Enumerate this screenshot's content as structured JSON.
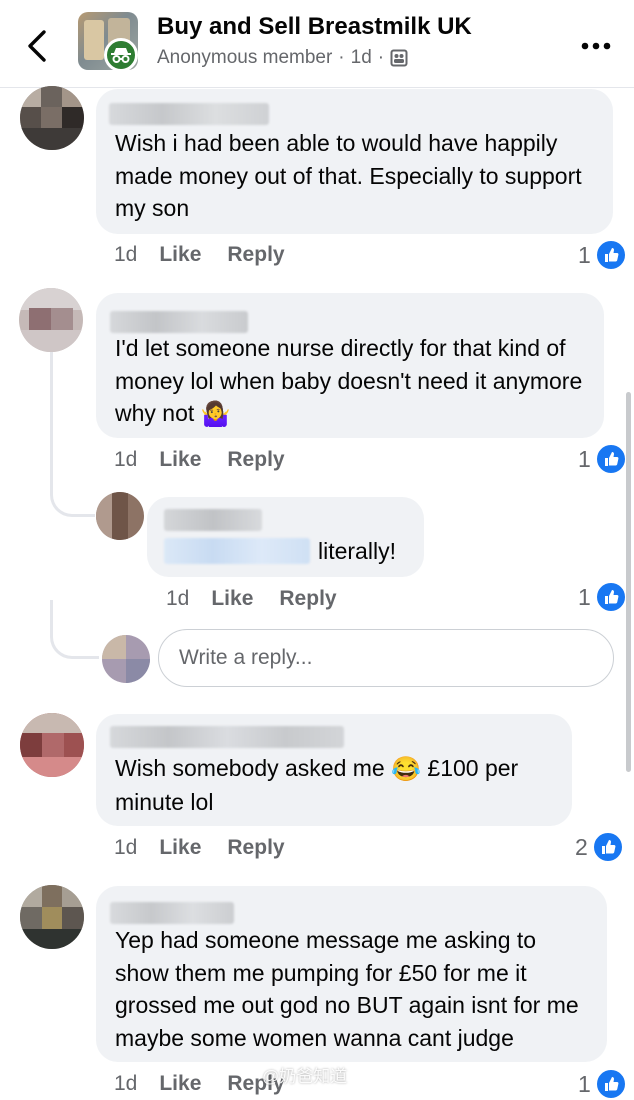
{
  "header": {
    "title": "Buy and Sell Breastmilk UK",
    "author": "Anonymous member",
    "time": "1d",
    "separator": "·"
  },
  "comments": [
    {
      "text": "Wish i had been able to would have happily made money out of that. Especially to support my son",
      "time": "1d",
      "like_label": "Like",
      "reply_label": "Reply",
      "reaction_count": "1"
    },
    {
      "text": "I'd let someone nurse directly for that kind of money lol when baby doesn't need it anymore why not",
      "emoji": "🤷‍♀️",
      "time": "1d",
      "like_label": "Like",
      "reply_label": "Reply",
      "reaction_count": "1"
    },
    {
      "text": "Wish somebody asked me",
      "emoji": "😂",
      "text_after": "£100 per minute lol",
      "time": "1d",
      "like_label": "Like",
      "reply_label": "Reply",
      "reaction_count": "2"
    },
    {
      "text": "Yep had someone message me asking to show them me pumping for £50 for me it grossed me out god no BUT again isnt for me maybe some women wanna cant judge",
      "time": "1d",
      "like_label": "Like",
      "reply_label": "Reply",
      "reaction_count": "1"
    }
  ],
  "reply": {
    "text": "literally!",
    "time": "1d",
    "like_label": "Like",
    "reply_label": "Reply",
    "reaction_count": "1"
  },
  "reply_input": {
    "placeholder": "Write a reply..."
  },
  "watermark": "@奶爸知道",
  "colors": {
    "like_blue": "#1877f2",
    "bubble_bg": "#f0f2f5",
    "secondary_text": "#65676b"
  }
}
